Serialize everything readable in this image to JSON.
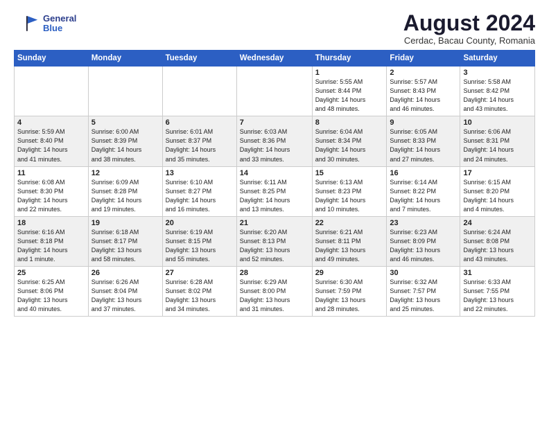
{
  "header": {
    "logo_line1": "General",
    "logo_line2": "Blue",
    "month_year": "August 2024",
    "location": "Cerdac, Bacau County, Romania"
  },
  "days_of_week": [
    "Sunday",
    "Monday",
    "Tuesday",
    "Wednesday",
    "Thursday",
    "Friday",
    "Saturday"
  ],
  "weeks": [
    [
      {
        "day": "",
        "info": ""
      },
      {
        "day": "",
        "info": ""
      },
      {
        "day": "",
        "info": ""
      },
      {
        "day": "",
        "info": ""
      },
      {
        "day": "1",
        "info": "Sunrise: 5:55 AM\nSunset: 8:44 PM\nDaylight: 14 hours\nand 48 minutes."
      },
      {
        "day": "2",
        "info": "Sunrise: 5:57 AM\nSunset: 8:43 PM\nDaylight: 14 hours\nand 46 minutes."
      },
      {
        "day": "3",
        "info": "Sunrise: 5:58 AM\nSunset: 8:42 PM\nDaylight: 14 hours\nand 43 minutes."
      }
    ],
    [
      {
        "day": "4",
        "info": "Sunrise: 5:59 AM\nSunset: 8:40 PM\nDaylight: 14 hours\nand 41 minutes."
      },
      {
        "day": "5",
        "info": "Sunrise: 6:00 AM\nSunset: 8:39 PM\nDaylight: 14 hours\nand 38 minutes."
      },
      {
        "day": "6",
        "info": "Sunrise: 6:01 AM\nSunset: 8:37 PM\nDaylight: 14 hours\nand 35 minutes."
      },
      {
        "day": "7",
        "info": "Sunrise: 6:03 AM\nSunset: 8:36 PM\nDaylight: 14 hours\nand 33 minutes."
      },
      {
        "day": "8",
        "info": "Sunrise: 6:04 AM\nSunset: 8:34 PM\nDaylight: 14 hours\nand 30 minutes."
      },
      {
        "day": "9",
        "info": "Sunrise: 6:05 AM\nSunset: 8:33 PM\nDaylight: 14 hours\nand 27 minutes."
      },
      {
        "day": "10",
        "info": "Sunrise: 6:06 AM\nSunset: 8:31 PM\nDaylight: 14 hours\nand 24 minutes."
      }
    ],
    [
      {
        "day": "11",
        "info": "Sunrise: 6:08 AM\nSunset: 8:30 PM\nDaylight: 14 hours\nand 22 minutes."
      },
      {
        "day": "12",
        "info": "Sunrise: 6:09 AM\nSunset: 8:28 PM\nDaylight: 14 hours\nand 19 minutes."
      },
      {
        "day": "13",
        "info": "Sunrise: 6:10 AM\nSunset: 8:27 PM\nDaylight: 14 hours\nand 16 minutes."
      },
      {
        "day": "14",
        "info": "Sunrise: 6:11 AM\nSunset: 8:25 PM\nDaylight: 14 hours\nand 13 minutes."
      },
      {
        "day": "15",
        "info": "Sunrise: 6:13 AM\nSunset: 8:23 PM\nDaylight: 14 hours\nand 10 minutes."
      },
      {
        "day": "16",
        "info": "Sunrise: 6:14 AM\nSunset: 8:22 PM\nDaylight: 14 hours\nand 7 minutes."
      },
      {
        "day": "17",
        "info": "Sunrise: 6:15 AM\nSunset: 8:20 PM\nDaylight: 14 hours\nand 4 minutes."
      }
    ],
    [
      {
        "day": "18",
        "info": "Sunrise: 6:16 AM\nSunset: 8:18 PM\nDaylight: 14 hours\nand 1 minute."
      },
      {
        "day": "19",
        "info": "Sunrise: 6:18 AM\nSunset: 8:17 PM\nDaylight: 13 hours\nand 58 minutes."
      },
      {
        "day": "20",
        "info": "Sunrise: 6:19 AM\nSunset: 8:15 PM\nDaylight: 13 hours\nand 55 minutes."
      },
      {
        "day": "21",
        "info": "Sunrise: 6:20 AM\nSunset: 8:13 PM\nDaylight: 13 hours\nand 52 minutes."
      },
      {
        "day": "22",
        "info": "Sunrise: 6:21 AM\nSunset: 8:11 PM\nDaylight: 13 hours\nand 49 minutes."
      },
      {
        "day": "23",
        "info": "Sunrise: 6:23 AM\nSunset: 8:09 PM\nDaylight: 13 hours\nand 46 minutes."
      },
      {
        "day": "24",
        "info": "Sunrise: 6:24 AM\nSunset: 8:08 PM\nDaylight: 13 hours\nand 43 minutes."
      }
    ],
    [
      {
        "day": "25",
        "info": "Sunrise: 6:25 AM\nSunset: 8:06 PM\nDaylight: 13 hours\nand 40 minutes."
      },
      {
        "day": "26",
        "info": "Sunrise: 6:26 AM\nSunset: 8:04 PM\nDaylight: 13 hours\nand 37 minutes."
      },
      {
        "day": "27",
        "info": "Sunrise: 6:28 AM\nSunset: 8:02 PM\nDaylight: 13 hours\nand 34 minutes."
      },
      {
        "day": "28",
        "info": "Sunrise: 6:29 AM\nSunset: 8:00 PM\nDaylight: 13 hours\nand 31 minutes."
      },
      {
        "day": "29",
        "info": "Sunrise: 6:30 AM\nSunset: 7:59 PM\nDaylight: 13 hours\nand 28 minutes."
      },
      {
        "day": "30",
        "info": "Sunrise: 6:32 AM\nSunset: 7:57 PM\nDaylight: 13 hours\nand 25 minutes."
      },
      {
        "day": "31",
        "info": "Sunrise: 6:33 AM\nSunset: 7:55 PM\nDaylight: 13 hours\nand 22 minutes."
      }
    ]
  ]
}
